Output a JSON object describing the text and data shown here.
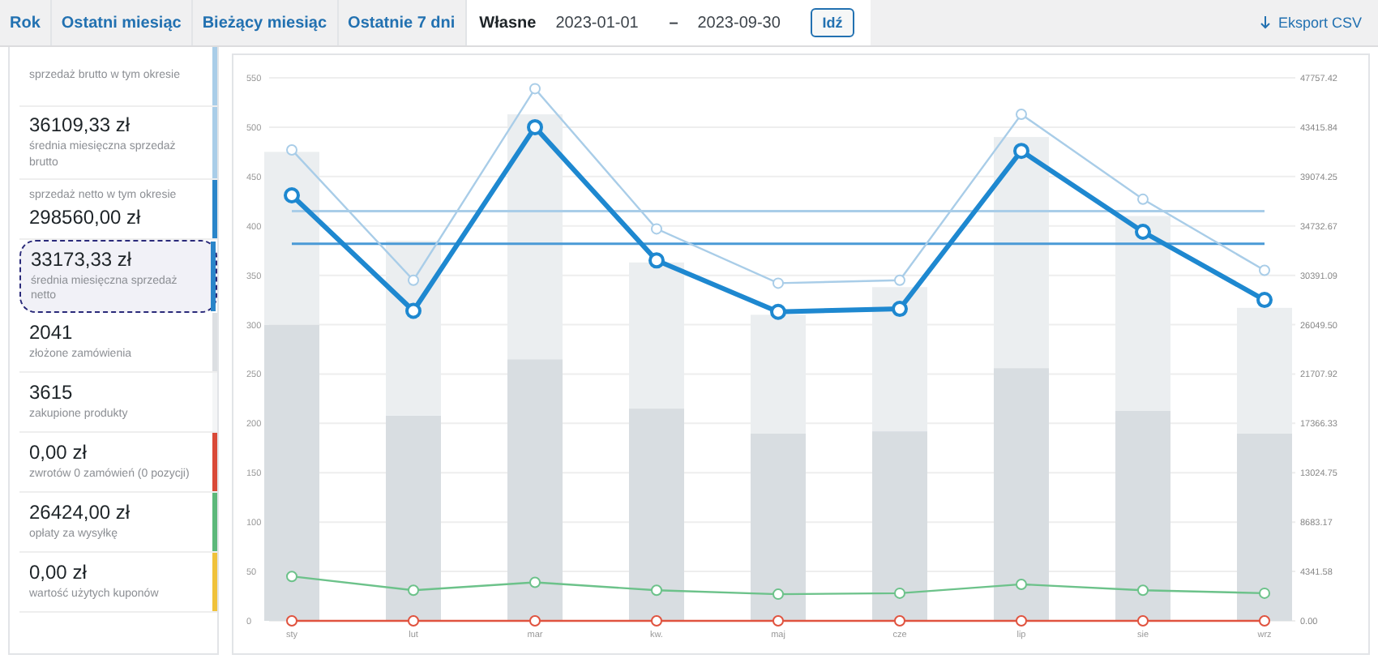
{
  "ranges": [
    {
      "label": "Rok",
      "selected": false
    },
    {
      "label": "Ostatni miesiąc",
      "selected": false
    },
    {
      "label": "Bieżący miesiąc",
      "selected": false
    },
    {
      "label": "Ostatnie 7 dni",
      "selected": false
    }
  ],
  "custom_range": {
    "label": "Własne",
    "selected": true,
    "from": "2023-01-01",
    "separator": "–",
    "to": "2023-09-30",
    "button": "Idź"
  },
  "export": {
    "label": "Eksport CSV"
  },
  "summary": [
    {
      "kind": "total",
      "label": "sprzedaż brutto w tym okresie",
      "color": "#a9cde8",
      "selected": false
    },
    {
      "kind": "average",
      "value": "36109,33 zł",
      "label": "średnia miesięczna sprzedaż brutto",
      "color": "#a9cde8",
      "selected": false
    },
    {
      "kind": "total",
      "value": "298560,00 zł",
      "label": "sprzedaż netto w tym okresie",
      "color": "#2a85c9",
      "selected": false
    },
    {
      "kind": "average",
      "value": "33173,33 zł",
      "label": "średnia miesięczna sprzedaż netto",
      "color": "#2a85c9",
      "selected": true
    },
    {
      "kind": "average",
      "value": "2041",
      "label": "złożone zamówienia",
      "color": "#dcdfe2",
      "selected": false
    },
    {
      "kind": "average",
      "value": "3615",
      "label": "zakupione produkty",
      "color": "#f4f5f6",
      "selected": false
    },
    {
      "kind": "average",
      "value": "0,00 zł",
      "label": "zwrotów 0 zamówień (0 pozycji)",
      "color": "#d94a38",
      "selected": false
    },
    {
      "kind": "average",
      "value": "26424,00 zł",
      "label": "opłaty za wysyłkę",
      "color": "#5cb87a",
      "selected": false
    },
    {
      "kind": "average",
      "value": "0,00 zł",
      "label": "wartość użytych kuponów",
      "color": "#f0c23b",
      "selected": false
    }
  ],
  "chart": {
    "chart_data": {
      "type": "bar",
      "stacked": true,
      "categories": [
        "sty",
        "lut",
        "mar",
        "kw.",
        "maj",
        "cze",
        "lip",
        "sie",
        "wrz"
      ],
      "ylim": [
        0,
        550
      ],
      "yticks": [
        0,
        50,
        100,
        150,
        200,
        250,
        300,
        350,
        400,
        450,
        500,
        550
      ],
      "annotations": [
        "0.00",
        "4341.58",
        "8683.17",
        "13024.75",
        "17366.33",
        "21707.92",
        "26049.50",
        "30391.09",
        "34732.67",
        "39074.25",
        "43415.84",
        "47757.42"
      ],
      "series": [
        {
          "type": "bar",
          "color": "#d8dde1",
          "values": [
            300,
            208,
            265,
            215,
            190,
            192,
            256,
            213,
            190
          ]
        },
        {
          "type": "bar",
          "color": "#ebeef0",
          "values": [
            175,
            177,
            248,
            148,
            120,
            146,
            234,
            197,
            127
          ]
        },
        {
          "type": "line",
          "color": "#a9cde8",
          "values": [
            415,
            415,
            415,
            415,
            415,
            415,
            415,
            415,
            415
          ]
        },
        {
          "type": "line",
          "color": "#4a9ad6",
          "values": [
            382,
            382,
            382,
            382,
            382,
            382,
            382,
            382,
            382
          ]
        },
        {
          "type": "line",
          "marker": "circle",
          "color": "#a9cde8",
          "values": [
            477,
            345,
            539,
            397,
            342,
            345,
            513,
            427,
            355
          ]
        },
        {
          "type": "line",
          "marker": "circle",
          "color": "#1e88d0",
          "values": [
            431,
            314,
            500,
            365,
            313,
            316,
            476,
            394,
            325
          ]
        },
        {
          "type": "line",
          "marker": "circle",
          "color": "#6cc28a",
          "values": [
            45,
            31,
            39,
            31,
            27,
            28,
            37,
            31,
            28
          ]
        },
        {
          "type": "line",
          "marker": "circle",
          "color": "#e0533f",
          "values": [
            0,
            0,
            0,
            0,
            0,
            0,
            0,
            0,
            0
          ]
        }
      ]
    }
  }
}
